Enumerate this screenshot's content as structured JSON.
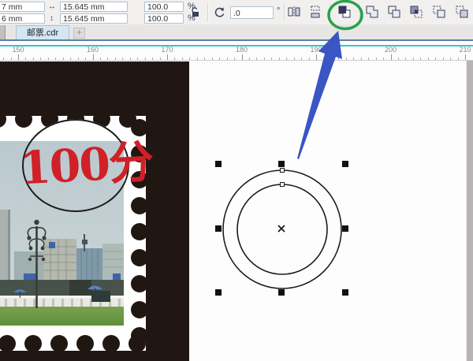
{
  "property_bar": {
    "position": {
      "x": "7 mm",
      "y": "6 mm"
    },
    "size": {
      "width": "15.645 mm",
      "height": "15.645 mm"
    },
    "scale": {
      "width": "100.0",
      "height": "100.0",
      "unit": "%"
    },
    "rotation": {
      "value": ".0",
      "unit": "°"
    }
  },
  "tab_bar": {
    "active_tab": "邮票.cdr",
    "new_tab": "+"
  },
  "ruler": {
    "labels": [
      "150",
      "160",
      "170",
      "180",
      "190",
      "200",
      "210"
    ]
  },
  "canvas": {
    "stamp": {
      "denomination": "100分"
    }
  },
  "colors": {
    "stamp_black": "#211712",
    "denom_red": "#d02028",
    "arrow_blue": "#3a55c4",
    "highlight_green": "#28a24c",
    "teal_line": "#3ac4c8",
    "tab_active_bg": "#d4e6f4"
  }
}
